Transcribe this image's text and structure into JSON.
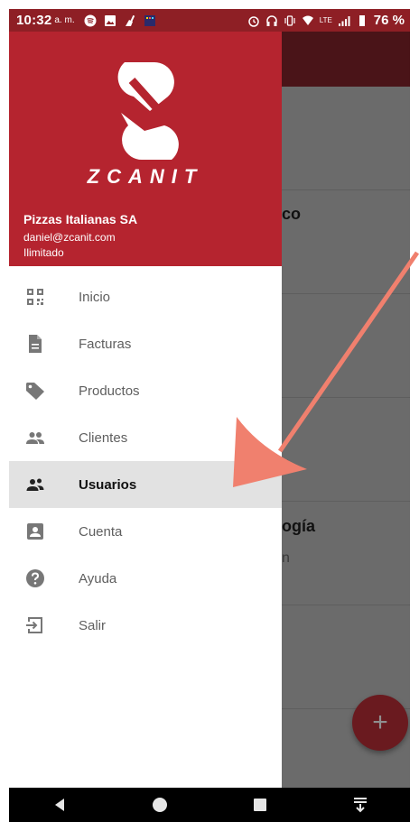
{
  "status_bar": {
    "time": "10:32",
    "ampm": "a. m.",
    "network": "LTE",
    "battery": "76 %"
  },
  "drawer": {
    "brand": "ZCANIT",
    "company": "Pizzas Italianas SA",
    "email": "daniel@zcanit.com",
    "plan": "Ilimitado",
    "active_item": "Usuarios",
    "items": [
      {
        "label": "Inicio",
        "icon": "qr-code-icon"
      },
      {
        "label": "Facturas",
        "icon": "document-icon"
      },
      {
        "label": "Productos",
        "icon": "tag-icon"
      },
      {
        "label": "Clientes",
        "icon": "people-icon"
      },
      {
        "label": "Usuarios",
        "icon": "users-icon"
      },
      {
        "label": "Cuenta",
        "icon": "account-box-icon"
      },
      {
        "label": "Ayuda",
        "icon": "help-icon"
      },
      {
        "label": "Salir",
        "icon": "exit-icon"
      }
    ]
  },
  "background": {
    "texts": [
      "co",
      "ogía"
    ],
    "subtexts": [
      "n",
      "n"
    ],
    "fab_label": "+"
  },
  "colors": {
    "header": "#b5242f",
    "status_bar": "#8e1f25",
    "arrow": "#f0806e",
    "active_row": "#e2e2e2"
  }
}
